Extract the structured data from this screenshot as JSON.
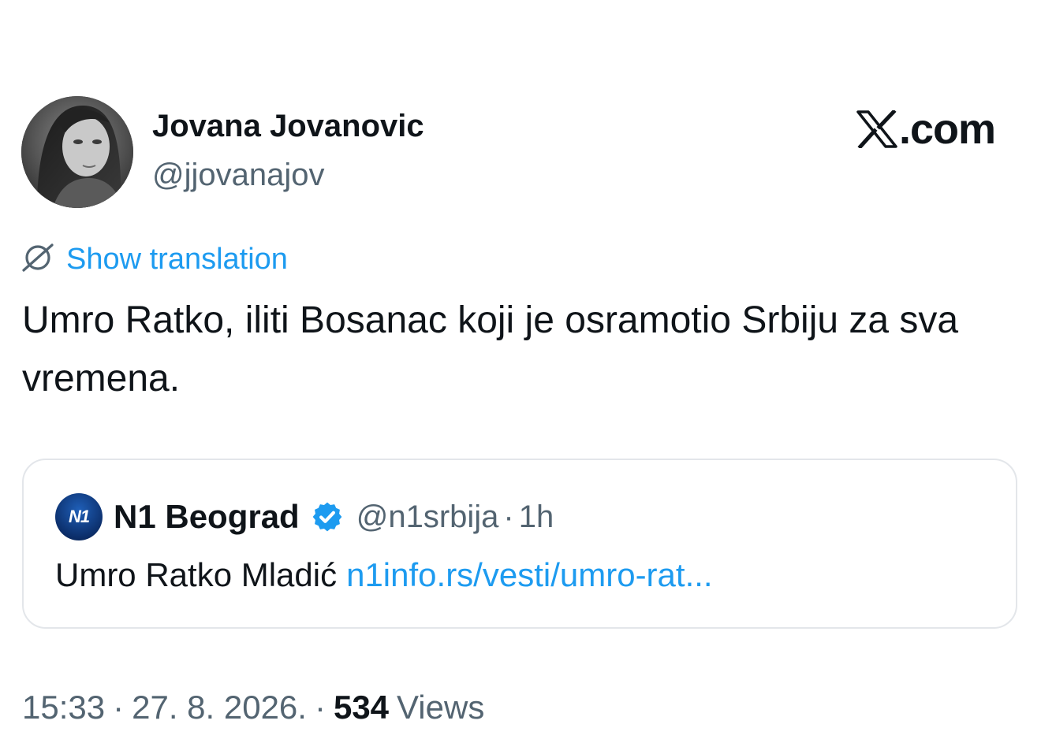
{
  "author": {
    "name": "Jovana Jovanovic",
    "handle": "@jjovanajov"
  },
  "brand": {
    "label": ".com",
    "logo_icon": "x-logo-icon"
  },
  "translate": {
    "icon": "translate-icon",
    "label": "Show translation"
  },
  "tweet": {
    "text": "Umro Ratko, iliti Bosanac koji je osramotio Srbiju za sva vremena."
  },
  "quote": {
    "name": "N1 Beograd",
    "logo_text": "N1",
    "verified_icon": "verified-badge-icon",
    "handle": "@n1srbija",
    "separator": "·",
    "time": "1h",
    "text": "Umro Ratko Mladić",
    "link": "n1info.rs/vesti/umro-rat..."
  },
  "meta": {
    "time": "15:33",
    "separator": "·",
    "date": "27. 8. 2026.",
    "views_count": "534",
    "views_label": "Views"
  },
  "colors": {
    "link": "#1d9bf0",
    "text": "#0f1419",
    "secondary": "#536471",
    "verified": "#1d9bf0",
    "border": "#e3e6ea"
  }
}
